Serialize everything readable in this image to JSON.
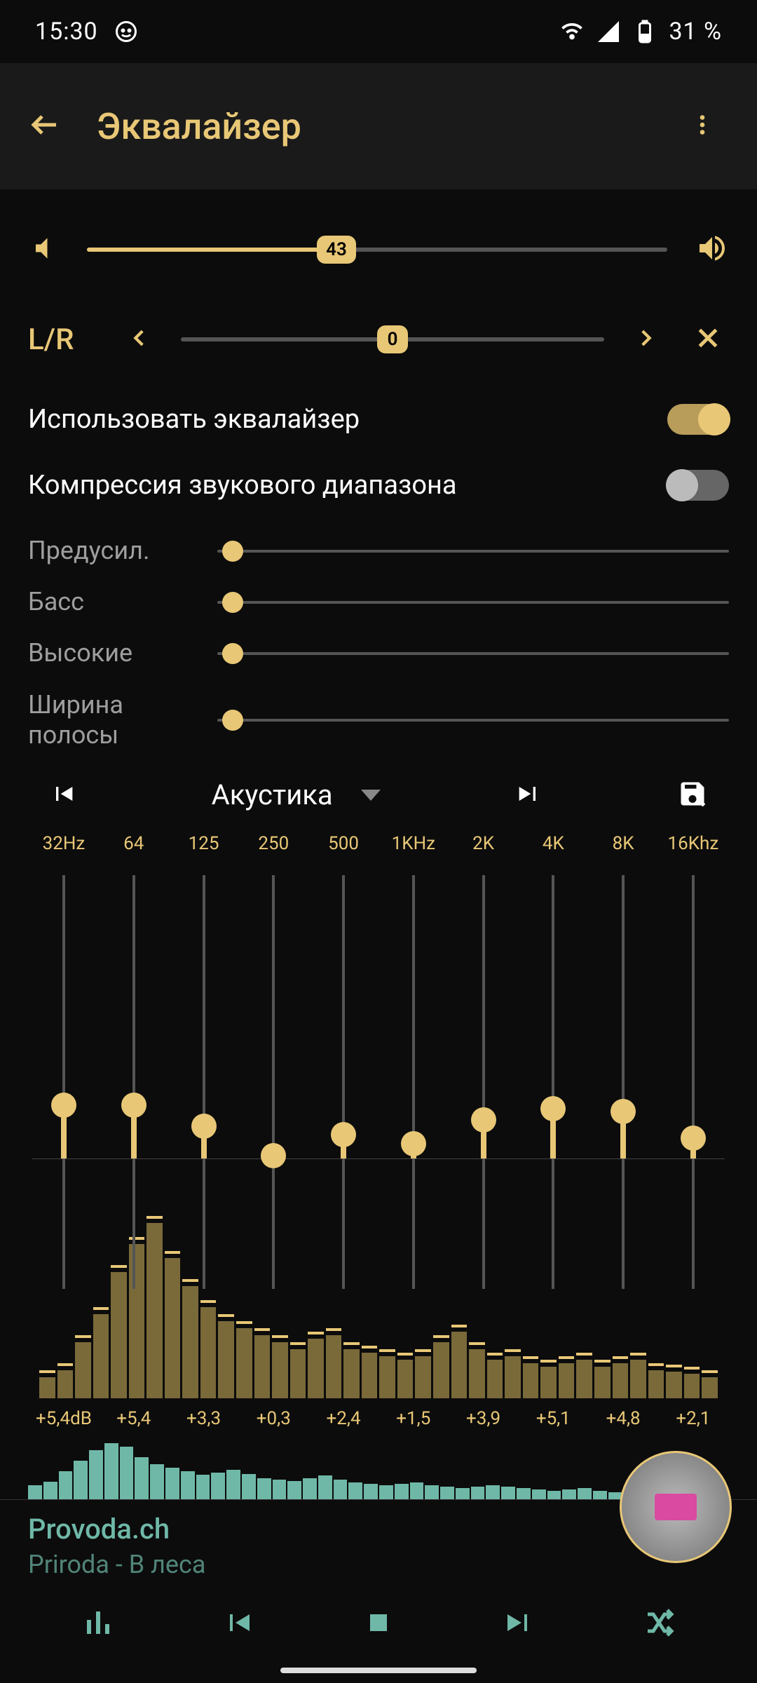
{
  "status": {
    "time": "15:30",
    "battery": "31 %"
  },
  "header": {
    "title": "Эквалайзер"
  },
  "volume": {
    "value": "43",
    "percent": 43
  },
  "balance": {
    "label": "L/R",
    "value": "0",
    "percent": 50
  },
  "toggles": {
    "eq_label": "Использовать эквалайзер",
    "eq_on": true,
    "comp_label": "Компрессия звукового диапазона",
    "comp_on": false
  },
  "sliders": {
    "preamp": "Предусил.",
    "bass": "Басс",
    "treble": "Высокие",
    "width": "Ширина полосы"
  },
  "preset": {
    "name": "Акустика"
  },
  "eq": {
    "freqs": [
      "32Hz",
      "64",
      "125",
      "250",
      "500",
      "1KHz",
      "2K",
      "4K",
      "8K",
      "16Khz"
    ],
    "gains_display": [
      "+5,4dB",
      "+5,4",
      "+3,3",
      "+0,3",
      "+2,4",
      "+1,5",
      "+3,9",
      "+5,1",
      "+4,8",
      "+2,1"
    ],
    "gains": [
      5.4,
      5.4,
      3.3,
      0.3,
      2.4,
      1.5,
      3.9,
      5.1,
      4.8,
      2.1
    ]
  },
  "spectrum": [
    30,
    40,
    80,
    120,
    180,
    220,
    250,
    200,
    160,
    130,
    110,
    100,
    90,
    80,
    70,
    85,
    90,
    70,
    65,
    60,
    55,
    60,
    80,
    95,
    70,
    55,
    60,
    50,
    45,
    50,
    55,
    45,
    50,
    55,
    40,
    38,
    35,
    30
  ],
  "mini_spectrum": [
    20,
    25,
    40,
    55,
    70,
    80,
    75,
    60,
    50,
    45,
    40,
    35,
    38,
    42,
    36,
    30,
    28,
    26,
    30,
    34,
    28,
    24,
    22,
    20,
    22,
    24,
    20,
    18,
    16,
    18,
    20,
    18,
    16,
    14,
    12,
    14,
    16,
    12,
    10,
    10,
    8,
    8,
    8,
    8,
    8,
    8
  ],
  "now_playing": {
    "title": "Provoda.ch",
    "subtitle": "Priroda - В леса"
  }
}
